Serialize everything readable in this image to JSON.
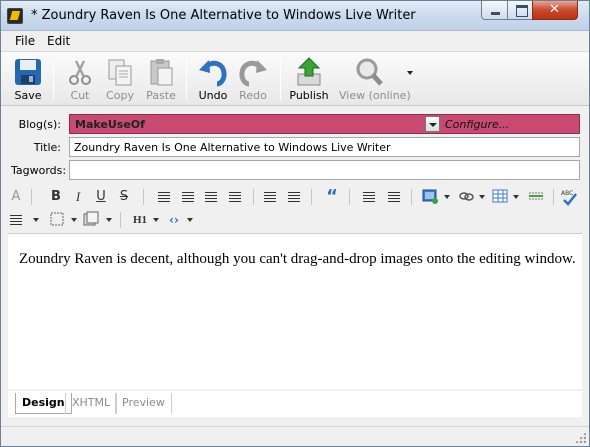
{
  "window": {
    "title": "* Zoundry Raven Is One Alternative to Windows Live Writer"
  },
  "menu": {
    "items": [
      "File",
      "Edit"
    ]
  },
  "toolbar": {
    "save": "Save",
    "cut": "Cut",
    "copy": "Copy",
    "paste": "Paste",
    "undo": "Undo",
    "redo": "Redo",
    "publish": "Publish",
    "view_online": "View (online)"
  },
  "fields": {
    "blogs_label": "Blog(s):",
    "blog_value": "MakeUseOf",
    "configure": "Configure...",
    "title_label": "Title:",
    "title_value": "Zoundry Raven Is One Alternative to Windows Live Writer",
    "tagwords_label": "Tagwords:",
    "tagwords_value": ""
  },
  "format": {
    "bold": "B",
    "italic": "I",
    "underline": "U",
    "strike": "S",
    "heading": "H1",
    "quote": "“"
  },
  "editor": {
    "content": "Zoundry Raven is decent, although you can't drag-and-drop images onto the editing window."
  },
  "tabs": [
    "Design",
    "XHTML",
    "Preview"
  ],
  "colors": {
    "blog_highlight": "#c94a70"
  }
}
